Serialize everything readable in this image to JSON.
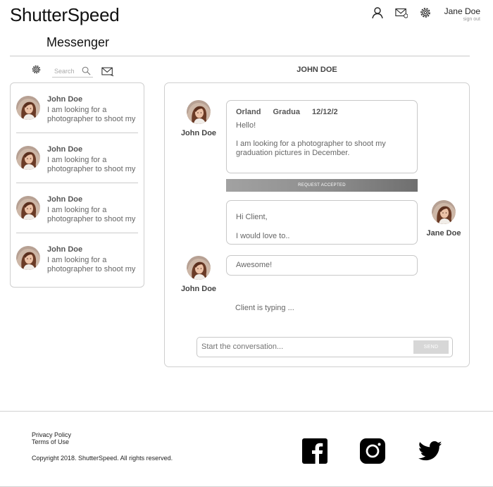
{
  "app": {
    "brand": "ShutterSpeed",
    "page_title": "Messenger"
  },
  "header": {
    "icons": [
      "user-icon",
      "mail-icon",
      "gear-icon"
    ],
    "user_name": "Jane Doe",
    "sign_out": "sign out"
  },
  "toolbar": {
    "search_placeholder": "Search"
  },
  "conversation": {
    "title": "JOHN DOE"
  },
  "conversations": [
    {
      "name": "John Doe",
      "snippet": "I am looking for a photographer to shoot my graduation pictures in December."
    },
    {
      "name": "John Doe",
      "snippet": "I am looking for a photographer to shoot my graduation pictures in December."
    },
    {
      "name": "John Doe",
      "snippet": "I am looking for a photographer to shoot my graduation pictures in December."
    },
    {
      "name": "John Doe",
      "snippet": "I am looking for a photographer to shoot my graduation pictures in December."
    }
  ],
  "messages": {
    "first": {
      "sender": "John Doe",
      "meta": [
        "Orland",
        "Gradua",
        "12/12/2"
      ],
      "greeting": "Hello!",
      "body": "I am looking for a photographer to shoot my graduation pictures in December."
    },
    "status_bar": "REQUEST ACCEPTED",
    "second": {
      "sender": "Jane Doe",
      "line1": "Hi Client,",
      "line2": "I would love to.."
    },
    "third": {
      "sender": "John Doe",
      "text": "Awesome!"
    },
    "typing": "Client is typing ..."
  },
  "composer": {
    "placeholder": "Start the conversation...",
    "send_label": "SEND"
  },
  "footer": {
    "privacy": "Privacy Policy",
    "terms": "Terms of Use",
    "copyright": "Copyright 2018. ShutterSpeed. All rights reserved.",
    "social_icons": [
      "facebook-icon",
      "instagram-icon",
      "twitter-icon"
    ]
  }
}
